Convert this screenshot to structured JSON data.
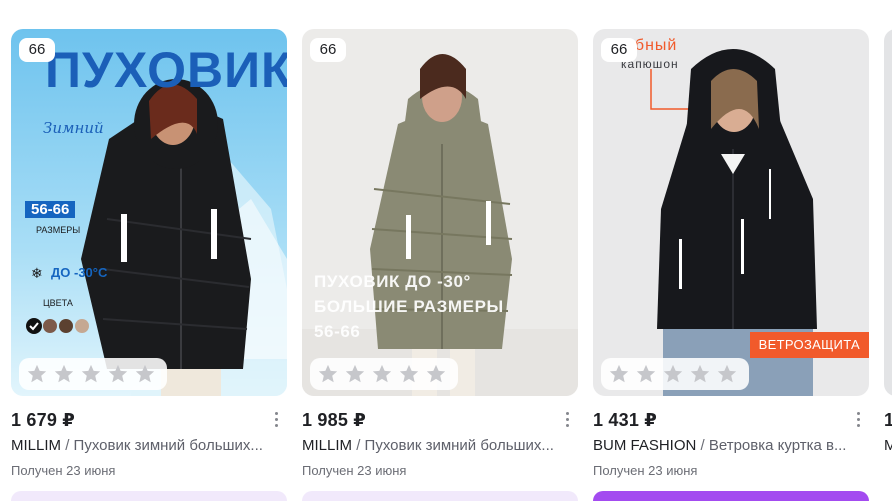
{
  "products": [
    {
      "size": "66",
      "rating_stars": 5,
      "price": "1 679 ₽",
      "brand": "MILLIM",
      "separator": "/",
      "name": "Пуховик зимний больших...",
      "delivery": "Получен 23 июня",
      "promo": {
        "headline": "ПУХОВИК",
        "script": "Зимний",
        "sizes": "56-66",
        "sizes_label": "РАЗМЕРЫ",
        "temp": "ДО -30°С",
        "colors_label": "ЦВЕТА"
      },
      "colors": {
        "bg_top": "#79c9ef",
        "bg_bottom": "#d6f1fb",
        "coat": "#1a1b1d",
        "accent": "#1565c0"
      }
    },
    {
      "size": "66",
      "rating_stars": 5,
      "price": "1 985 ₽",
      "brand": "MILLIM",
      "separator": "/",
      "name": "Пуховик зимний больших...",
      "delivery": "Получен 23 июня",
      "promo": {
        "line1": "ПУХОВИК ДО -30°",
        "line2": "БОЛЬШИЕ РАЗМЕРЫ",
        "line3": "56-66"
      },
      "colors": {
        "bg": "#ecebe9",
        "coat": "#8a8a74"
      }
    },
    {
      "size": "66",
      "rating_stars": 5,
      "price": "1 431 ₽",
      "brand": "BUM FASHION",
      "separator": "/",
      "name": "Ветровка куртка в...",
      "delivery": "Получен 23 июня",
      "promo": {
        "top_line1": "обный",
        "top_line2": "капюшон",
        "badge": "ВЕТРОЗАЩИТА"
      },
      "colors": {
        "bg": "#e9e9ea",
        "coat": "#17181c",
        "badge": "#f15a2b"
      }
    }
  ],
  "partial": {
    "price": "1",
    "line": "M"
  }
}
